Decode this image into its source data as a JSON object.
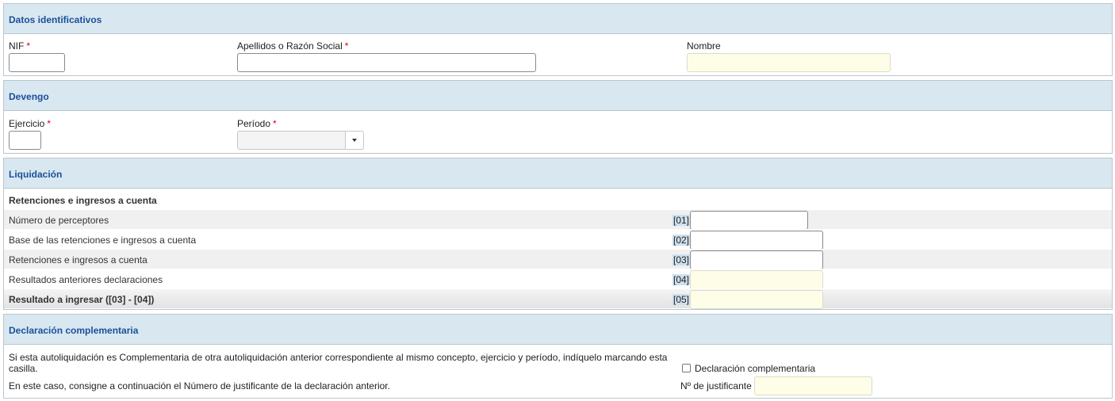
{
  "datos": {
    "title": "Datos identificativos",
    "nif_label": "NIF",
    "apellidos_label": "Apellidos o Razón Social",
    "nombre_label": "Nombre",
    "required_mark": "*"
  },
  "devengo": {
    "title": "Devengo",
    "ejercicio_label": "Ejercicio",
    "periodo_label": "Período",
    "required_mark": "*"
  },
  "liquidacion": {
    "title": "Liquidación",
    "group_title": "Retenciones e ingresos a cuenta",
    "rows": [
      {
        "label": "Número de perceptores",
        "code": "[01]"
      },
      {
        "label": "Base de las retenciones e ingresos a cuenta",
        "code": "[02]"
      },
      {
        "label": "Retenciones e ingresos a cuenta",
        "code": "[03]"
      },
      {
        "label": "Resultados anteriores declaraciones",
        "code": "[04]"
      },
      {
        "label": "Resultado a ingresar ([03] - [04])",
        "code": "[05]"
      }
    ]
  },
  "complementaria": {
    "title": "Declaración complementaria",
    "text1": "Si esta autoliquidación es Complementaria de otra autoliquidación anterior correspondiente al mismo concepto, ejercicio y período, indíquelo marcando esta casilla.",
    "checkbox_label": "Declaración complementaria",
    "text2": "En este caso, consigne a continuación el Número de justificante de la declaración anterior.",
    "justificante_label": "Nº de justificante"
  },
  "colors": {
    "section_header_bg": "#d9e8f0",
    "section_title": "#1a4f9c",
    "readonly_input_bg": "#fdfde8",
    "required": "#d0021b"
  }
}
